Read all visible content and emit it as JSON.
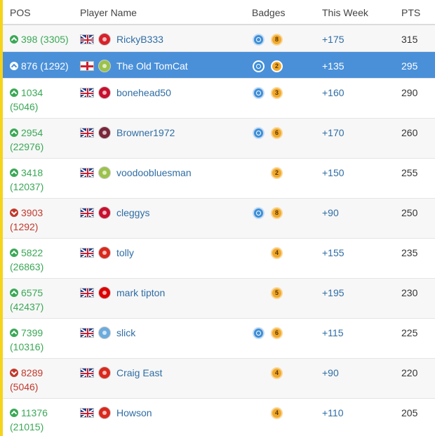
{
  "header": {
    "pos": "POS",
    "player": "Player Name",
    "badges": "Badges",
    "week": "This Week",
    "pts": "PTS"
  },
  "colors": {
    "highlight_row": "#4a90d9",
    "up": "#3aa856",
    "down": "#c0392b",
    "link": "#2e6da4",
    "accent": "#f5d31a"
  },
  "rows": [
    {
      "pos_line1": "398 (3305)",
      "pos_line2": "",
      "trend": "up",
      "flag": "uk-flag-icon",
      "crest": "arsenal-crest-icon",
      "crest_color": "#d8222b",
      "name": "RickyB333",
      "badge_blue": true,
      "badge_gold": "8",
      "week": "+175",
      "pts": "315",
      "style": "alt"
    },
    {
      "pos_line1": "876 (1292)",
      "pos_line2": "",
      "trend": "up",
      "flag": "england-flag-icon",
      "crest": "yeovil-crest-icon",
      "crest_color": "#9bc24a",
      "name": "The Old TomCat",
      "badge_blue": true,
      "badge_gold": "2",
      "week": "+135",
      "pts": "295",
      "style": "highlight"
    },
    {
      "pos_line1": "1034",
      "pos_line2": "(5046)",
      "trend": "up",
      "flag": "uk-flag-icon",
      "crest": "cheltenham-crest-icon",
      "crest_color": "#c8102e",
      "name": "bonehead50",
      "badge_blue": true,
      "badge_gold": "3",
      "week": "+160",
      "pts": "290",
      "style": "white"
    },
    {
      "pos_line1": "2954",
      "pos_line2": "(22976)",
      "trend": "up",
      "flag": "uk-flag-icon",
      "crest": "westham-crest-icon",
      "crest_color": "#7a263a",
      "name": "Browner1972",
      "badge_blue": true,
      "badge_gold": "6",
      "week": "+170",
      "pts": "260",
      "style": "alt"
    },
    {
      "pos_line1": "3418",
      "pos_line2": "(12037)",
      "trend": "up",
      "flag": "uk-flag-icon",
      "crest": "yeovil-crest-icon",
      "crest_color": "#9bc24a",
      "name": "voodoobluesman",
      "badge_blue": false,
      "badge_gold": "2",
      "week": "+150",
      "pts": "255",
      "style": "white"
    },
    {
      "pos_line1": "3903",
      "pos_line2": "(1292)",
      "trend": "down",
      "flag": "uk-flag-icon",
      "crest": "liverpool-crest-icon",
      "crest_color": "#c8102e",
      "name": "cleggys",
      "badge_blue": true,
      "badge_gold": "8",
      "week": "+90",
      "pts": "250",
      "style": "alt"
    },
    {
      "pos_line1": "5822",
      "pos_line2": "(26863)",
      "trend": "up",
      "flag": "uk-flag-icon",
      "crest": "manutd-crest-icon",
      "crest_color": "#da291c",
      "name": "tolly",
      "badge_blue": false,
      "badge_gold": "4",
      "week": "+155",
      "pts": "235",
      "style": "white"
    },
    {
      "pos_line1": "6575",
      "pos_line2": "(42437)",
      "trend": "up",
      "flag": "uk-flag-icon",
      "crest": "forest-crest-icon",
      "crest_color": "#dd0000",
      "name": "mark tipton",
      "badge_blue": false,
      "badge_gold": "5",
      "week": "+195",
      "pts": "230",
      "style": "alt"
    },
    {
      "pos_line1": "7399",
      "pos_line2": "(10316)",
      "trend": "up",
      "flag": "uk-flag-icon",
      "crest": "mancity-crest-icon",
      "crest_color": "#6cabdd",
      "name": "slick",
      "badge_blue": true,
      "badge_gold": "6",
      "week": "+115",
      "pts": "225",
      "style": "white"
    },
    {
      "pos_line1": "8289",
      "pos_line2": "(5046)",
      "trend": "down",
      "flag": "uk-flag-icon",
      "crest": "manutd-crest-icon",
      "crest_color": "#da291c",
      "name": "Craig East",
      "badge_blue": false,
      "badge_gold": "4",
      "week": "+90",
      "pts": "220",
      "style": "alt"
    },
    {
      "pos_line1": "11376",
      "pos_line2": "(21015)",
      "trend": "up",
      "flag": "uk-flag-icon",
      "crest": "manutd-crest-icon",
      "crest_color": "#da291c",
      "name": "Howson",
      "badge_blue": false,
      "badge_gold": "4",
      "week": "+110",
      "pts": "205",
      "style": "white"
    }
  ]
}
